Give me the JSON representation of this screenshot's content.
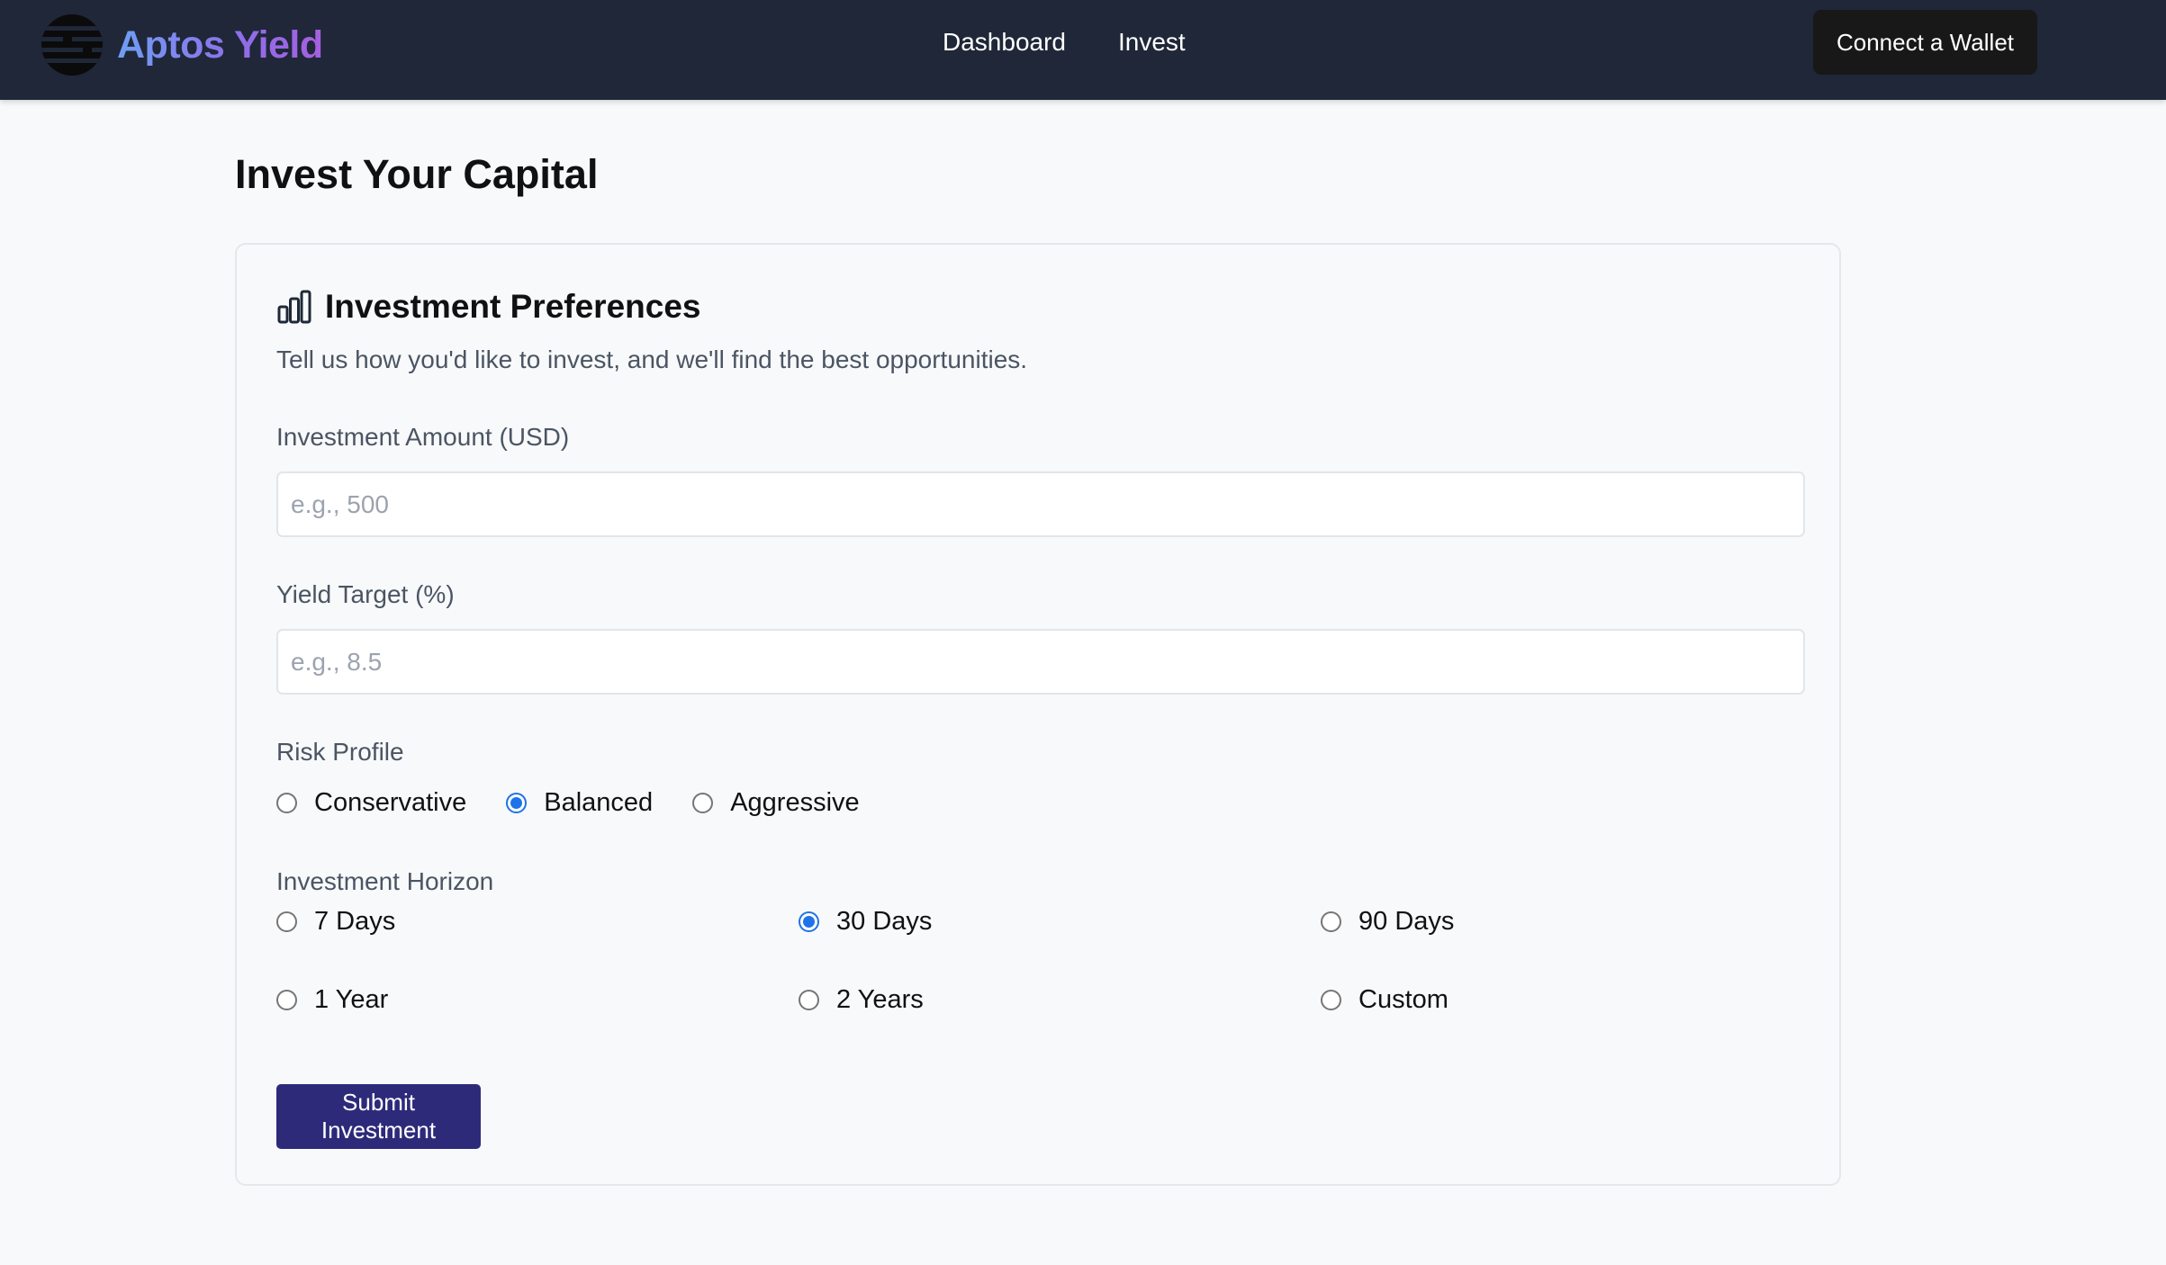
{
  "header": {
    "logo_icon": "striped-circle-logo",
    "brand_name": "Aptos Yield",
    "nav": [
      {
        "label": "Dashboard"
      },
      {
        "label": "Invest"
      }
    ],
    "connect_label": "Connect a Wallet"
  },
  "page": {
    "title": "Invest Your Capital"
  },
  "card": {
    "icon": "bar-chart-icon",
    "title": "Investment Preferences",
    "description": "Tell us how you'd like to invest, and we'll find the best opportunities.",
    "amount": {
      "label": "Investment Amount (USD)",
      "value": "",
      "placeholder": "e.g., 500"
    },
    "yield": {
      "label": "Yield Target (%)",
      "value": "",
      "placeholder": "e.g., 8.5"
    },
    "risk": {
      "label": "Risk Profile",
      "selected": "Balanced",
      "options": [
        {
          "label": "Conservative",
          "checked": false
        },
        {
          "label": "Balanced",
          "checked": true
        },
        {
          "label": "Aggressive",
          "checked": false
        }
      ]
    },
    "horizon": {
      "label": "Investment Horizon",
      "selected": "30 Days",
      "options": [
        {
          "label": "7 Days",
          "checked": false
        },
        {
          "label": "30 Days",
          "checked": true
        },
        {
          "label": "90 Days",
          "checked": false
        },
        {
          "label": "1 Year",
          "checked": false
        },
        {
          "label": "2 Years",
          "checked": false
        },
        {
          "label": "Custom",
          "checked": false
        }
      ]
    },
    "submit_label": "Submit Investment"
  },
  "colors": {
    "header_bg": "#1f2738",
    "brand_gradient_start": "#6f9ef5",
    "brand_gradient_end": "#a55fe0",
    "radio_checked": "#1f73e8",
    "submit_bg": "#2e2a7a",
    "connect_bg": "#181818",
    "page_bg": "#f8f9fb"
  }
}
